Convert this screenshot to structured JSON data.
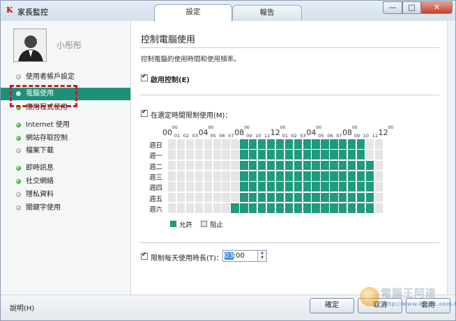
{
  "app": {
    "title": "家長監控",
    "logo": "K"
  },
  "tabs": [
    {
      "label": "設定"
    },
    {
      "label": "報告"
    }
  ],
  "window_controls": {
    "minimize": "—",
    "maximize": "□",
    "close": "✕"
  },
  "user": {
    "name": "小彤彤"
  },
  "sidebar": {
    "items": [
      {
        "label": "使用者帳戶設定",
        "status": "grey"
      },
      {
        "label": "電腦使用",
        "status": "green",
        "active": true
      },
      {
        "label": "應用程式使用",
        "status": "green"
      },
      {
        "label": "Internet 使用",
        "status": "green"
      },
      {
        "label": "網站存取控制",
        "status": "green"
      },
      {
        "label": "檔案下載",
        "status": "grey"
      },
      {
        "label": "即時訊息",
        "status": "green"
      },
      {
        "label": "社交網絡",
        "status": "green"
      },
      {
        "label": "隱私資料",
        "status": "grey"
      },
      {
        "label": "關鍵字使用",
        "status": "grey"
      }
    ],
    "help": "說明(H)"
  },
  "main": {
    "title": "控制電腦使用",
    "description": "控制電腦的使用時間和使用頻率。",
    "enable_control": {
      "label": "啟用控制(E)",
      "checked": true
    },
    "limit_schedule": {
      "label": "在選定時間限制使用(M)：",
      "checked": true
    },
    "hours_big": [
      "00",
      "04",
      "08",
      "12",
      "04",
      "08",
      "12"
    ],
    "hours_big_sup": "00",
    "hours_small": [
      "01",
      "02",
      "03",
      "05",
      "06",
      "07",
      "09",
      "10",
      "11",
      "01",
      "02",
      "03",
      "05",
      "06",
      "07",
      "09",
      "10",
      "11"
    ],
    "days": [
      "週日",
      "週一",
      "週二",
      "週三",
      "週四",
      "週五",
      "週六"
    ],
    "allowed_from_hour": [
      8,
      8,
      8,
      8,
      8,
      8,
      7
    ],
    "allowed_to_hour": [
      22,
      22,
      23,
      23,
      23,
      23,
      23
    ],
    "legend": {
      "allow": "允許",
      "block": "阻止"
    },
    "daily_limit": {
      "label": "限制每天使用時長(T)：",
      "checked": true,
      "value_hour": "03",
      "value_rest": ":00"
    }
  },
  "buttons": {
    "ok": "確定",
    "cancel": "取消",
    "apply": "套用"
  },
  "watermark": {
    "line1": "電腦王阿達",
    "line2": "http://www.kocpc.com.tw"
  },
  "colors": {
    "accent": "#1f9a7e",
    "active_nav": "#1f8f7a",
    "highlight": "#d41818"
  }
}
